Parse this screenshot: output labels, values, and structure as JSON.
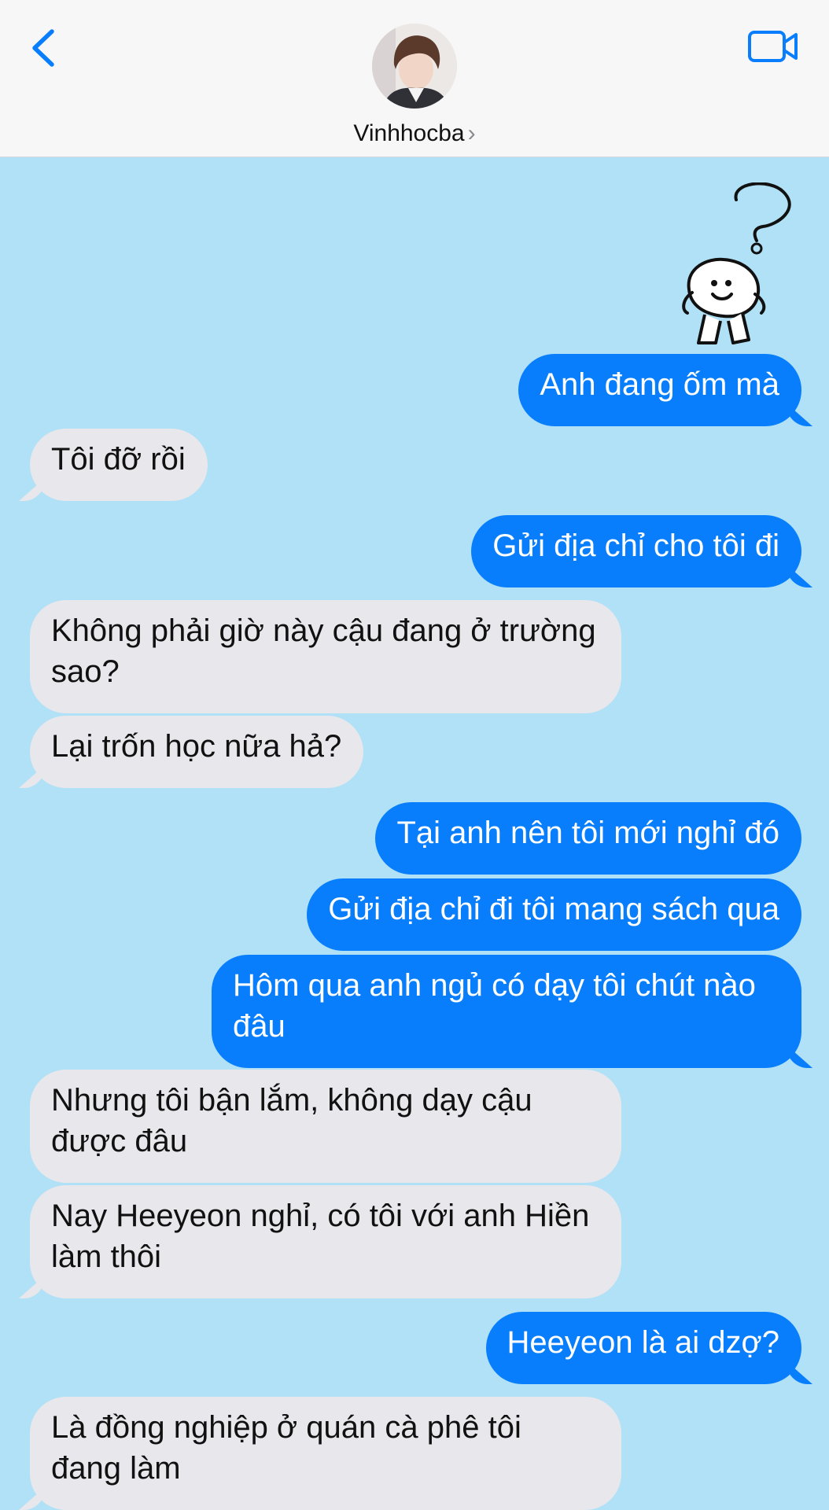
{
  "header": {
    "contact_name": "Vinhhocba",
    "chevron": "›",
    "back_icon": "chevron-left-icon",
    "video_icon": "video-camera-icon",
    "accent_color": "#087efc"
  },
  "chat": {
    "background_color": "#b1e1f6",
    "sticker": "smiley-question-sticker",
    "messages": [
      {
        "from": "me",
        "text": "Anh đang ốm mà"
      },
      {
        "from": "them",
        "text": "Tôi đỡ rồi"
      },
      {
        "from": "me",
        "text": "Gửi địa chỉ cho tôi đi"
      },
      {
        "from": "them",
        "text": "Không phải giờ này cậu đang ở trường sao?"
      },
      {
        "from": "them",
        "text": "Lại trốn học nữa hả?"
      },
      {
        "from": "me",
        "text": "Tại anh nên tôi mới nghỉ đó"
      },
      {
        "from": "me",
        "text": "Gửi địa chỉ đi tôi mang sách qua"
      },
      {
        "from": "me",
        "text": "Hôm qua anh ngủ có dạy tôi chút nào đâu"
      },
      {
        "from": "them",
        "text": "Nhưng tôi bận lắm, không dạy cậu được đâu"
      },
      {
        "from": "them",
        "text": "Nay Heeyeon nghỉ, có tôi với anh Hiền làm thôi"
      },
      {
        "from": "me",
        "text": "Heeyeon là ai dzợ?"
      },
      {
        "from": "them",
        "text": "Là đồng nghiệp ở quán cà phê tôi đang làm"
      }
    ]
  }
}
